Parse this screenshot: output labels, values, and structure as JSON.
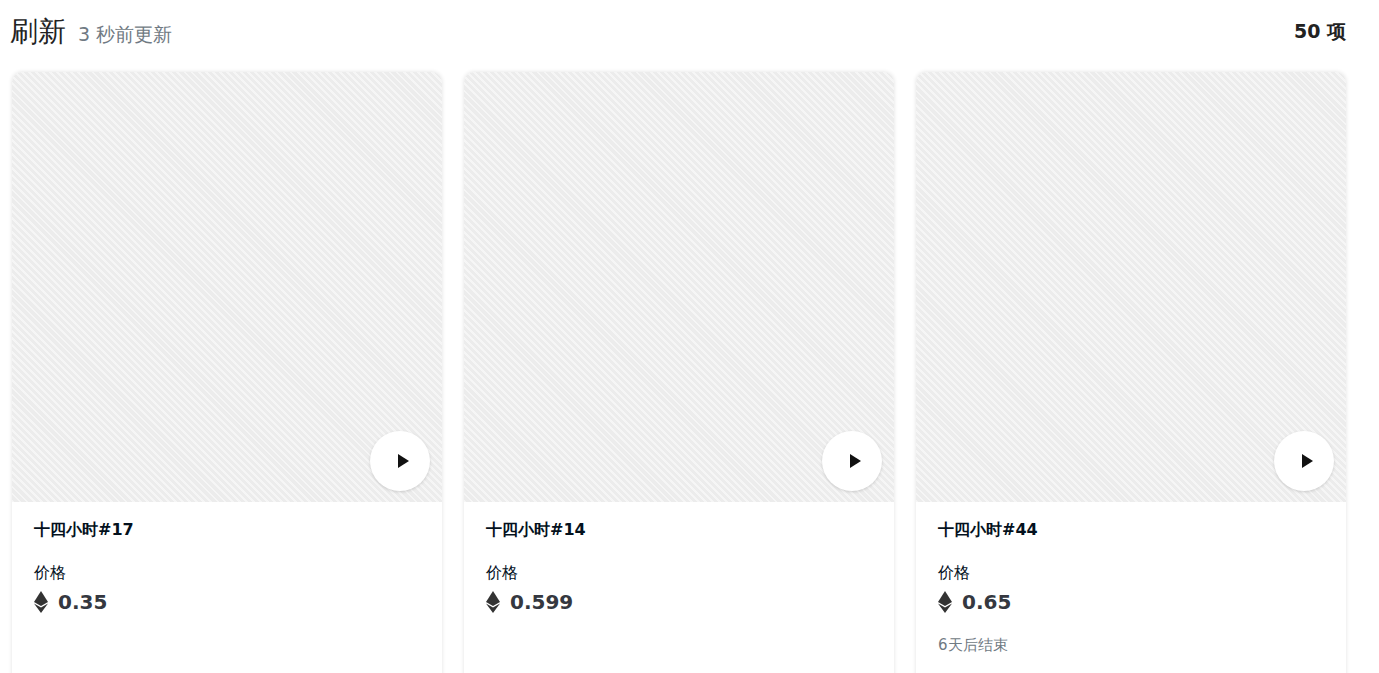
{
  "header": {
    "title": "刷新",
    "updated": "3 秒前更新",
    "count": "50 项"
  },
  "cards": [
    {
      "title": "十四小时#17",
      "price_label": "价格",
      "price": "0.35",
      "ends": ""
    },
    {
      "title": "十四小时#14",
      "price_label": "价格",
      "price": "0.599",
      "ends": ""
    },
    {
      "title": "十四小时#44",
      "price_label": "价格",
      "price": "0.65",
      "ends": "6天后结束"
    }
  ]
}
